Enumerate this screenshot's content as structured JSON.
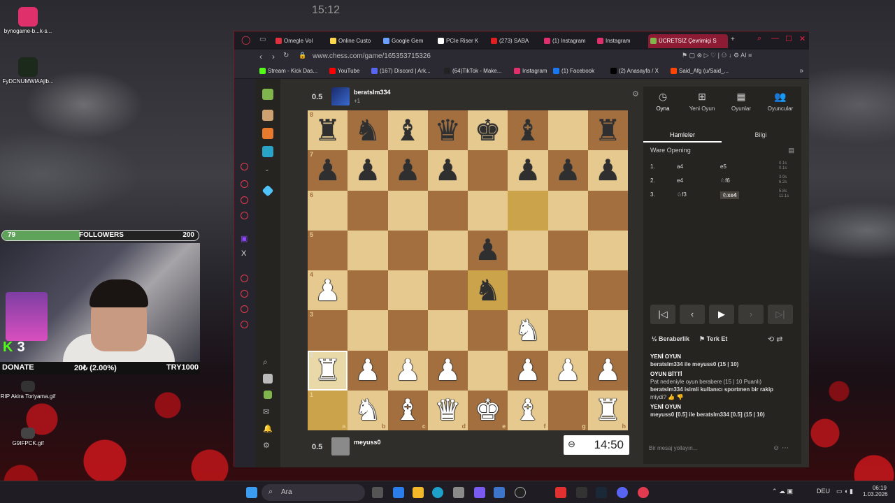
{
  "desktop": {
    "icons": [
      {
        "label": "bynogame-b...k-s...",
        "color": "#e0306c"
      },
      {
        "label": "FyDCNUMWlAAjlb...",
        "color": "#1c2a1c"
      },
      {
        "label": "RIP Akira Toriyama.gif",
        "color": "#333"
      },
      {
        "label": "G9IFPCK.gif",
        "color": "#444"
      }
    ]
  },
  "overlay": {
    "followers_current": "79",
    "followers_label": "FOLLOWERS",
    "followers_goal": "200",
    "followers_progress": 0.395,
    "kick_count": "3",
    "donate_label": "DONATE",
    "donate_progress": "20₺ (2.00%)",
    "donate_goal": "TRY1000"
  },
  "browser": {
    "tabs": [
      {
        "label": "Omegle Vol",
        "color": "#e03040"
      },
      {
        "label": "Online Custo",
        "color": "#ffd84d"
      },
      {
        "label": "Google Gem",
        "color": "#6aa0ff"
      },
      {
        "label": "PCIe Riser K",
        "color": "#ffffff"
      },
      {
        "label": "(273) SABA",
        "color": "#e02020"
      },
      {
        "label": "(1) Instagram",
        "color": "#e0306c"
      },
      {
        "label": "Instagram",
        "color": "#e0306c"
      },
      {
        "label": "ÜCRETSİZ Çevrimiçi S",
        "color": "#81b64c"
      }
    ],
    "url": "www.chess.com/game/165353715326",
    "bookmarks": [
      {
        "label": "Stream - Kick Das...",
        "color": "#53fc18"
      },
      {
        "label": "YouTube",
        "color": "#ff0000"
      },
      {
        "label": "(167) Discord | Ark...",
        "color": "#5865f2"
      },
      {
        "label": "(64)TikTok - Make...",
        "color": "#222"
      },
      {
        "label": "Instagram",
        "color": "#e0306c"
      },
      {
        "label": "(1) Facebook",
        "color": "#1877f2"
      },
      {
        "label": "(2) Anasayfa / X",
        "color": "#000"
      },
      {
        "label": "Said_Afg (u/Said_...",
        "color": "#ff4500"
      }
    ]
  },
  "game": {
    "top_player": {
      "score": "0.5",
      "name": "beratslm334",
      "sub": "+1"
    },
    "bottom_player": {
      "score": "0.5",
      "name": "meyuss0"
    },
    "top_clock": "15:12",
    "bottom_clock": "14:50",
    "board": [
      [
        "r",
        "n",
        "b",
        "q",
        "k",
        "b",
        "",
        "r"
      ],
      [
        "p",
        "p",
        "p",
        "p",
        "",
        "p",
        "p",
        "p"
      ],
      [
        "",
        "",
        "",
        "",
        "",
        "",
        "",
        ""
      ],
      [
        "",
        "",
        "",
        "",
        "p",
        "",
        "",
        ""
      ],
      [
        "P",
        "",
        "",
        "",
        "n",
        "",
        "",
        ""
      ],
      [
        "",
        "",
        "",
        "",
        "",
        "N",
        "",
        ""
      ],
      [
        "R",
        "P",
        "P",
        "P",
        "",
        "P",
        "P",
        "P"
      ],
      [
        "",
        "N",
        "B",
        "Q",
        "K",
        "B",
        "",
        "R"
      ]
    ],
    "ranks": [
      "8",
      "7",
      "6",
      "5",
      "4",
      "3",
      "2",
      "1"
    ],
    "files": [
      "a",
      "b",
      "c",
      "d",
      "e",
      "f",
      "g",
      "h"
    ],
    "highlight": [
      [
        2,
        5
      ],
      [
        4,
        4
      ]
    ],
    "selected": [
      6,
      0
    ],
    "last_from": [
      7,
      0
    ]
  },
  "panel": {
    "nav": [
      {
        "label": "Oyna",
        "icon": "◷"
      },
      {
        "label": "Yeni Oyun",
        "icon": "⊞"
      },
      {
        "label": "Oyunlar",
        "icon": "▦"
      },
      {
        "label": "Oyuncular",
        "icon": "👥"
      }
    ],
    "subtabs": [
      "Hamleler",
      "Bilgi"
    ],
    "opening": "Ware Opening",
    "moves": [
      {
        "n": "1.",
        "w": "a4",
        "b": "e5",
        "tw": "0.1s",
        "tb": "0.1s"
      },
      {
        "n": "2.",
        "w": "e4",
        "b": "♘f6",
        "tw": "3.9s",
        "tb": "6.2s"
      },
      {
        "n": "3.",
        "w": "♘f3",
        "b": "♘xe4",
        "tw": "5.8s",
        "tb": "11.1s"
      }
    ],
    "draw": "Beraberlik",
    "resign": "Terk Et",
    "chat": [
      {
        "cls": "h",
        "text": "YENİ OYUN"
      },
      {
        "cls": "b",
        "text": "beratslm334 ile meyuss0 (15 | 10)"
      },
      {
        "cls": "h",
        "text": "OYUN BİTTİ"
      },
      {
        "cls": "",
        "text": "Pat nedeniyle oyun berabere (15 | 10 Puanlı)"
      },
      {
        "cls": "b",
        "text": "beratslm334 isimli kullanıcı sportmen bir rakip"
      },
      {
        "cls": "",
        "text": "miydi? 👍 👎"
      },
      {
        "cls": "h",
        "text": "YENİ OYUN"
      },
      {
        "cls": "b",
        "text": "meyuss0 [0.5] ile beratslm334 [0.5] (15 | 10)"
      }
    ],
    "message_placeholder": "Bir mesaj yollayın..."
  },
  "taskbar": {
    "search": "Ara",
    "lang": "DEU",
    "time": "06:19",
    "date": "1.03.2026"
  }
}
